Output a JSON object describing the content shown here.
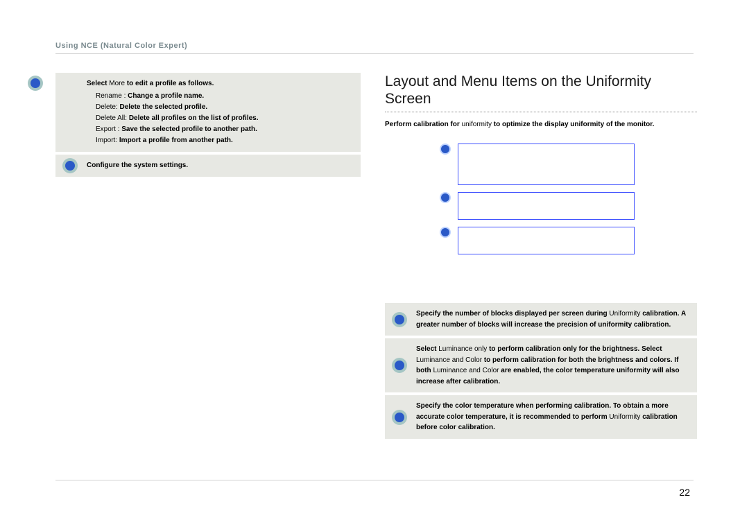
{
  "header": {
    "breadcrumb": "Using NCE (Natural Color Expert)"
  },
  "left": {
    "more_box": {
      "lead_strong": "Select",
      "lead_code": "More",
      "lead_tail": " to edit a profile as follows.",
      "items": [
        {
          "name": "Rename",
          "sep": " : ",
          "desc": "Change a profile name."
        },
        {
          "name": "Delete",
          "sep": ": ",
          "desc": "Delete the selected profile."
        },
        {
          "name": "Delete All",
          "sep": ": ",
          "desc": "Delete all profiles on the list of profiles."
        },
        {
          "name": "Export",
          "sep": " : ",
          "desc": "Save the selected profile to another path."
        },
        {
          "name": "Import",
          "sep": ": ",
          "desc": "Import a profile from another path."
        }
      ]
    },
    "settings_box": "Configure the system settings."
  },
  "right": {
    "title": "Layout and Menu Items on the Uniformity Screen",
    "intro_strong1": "Perform calibration for",
    "intro_code": "uniformity",
    "intro_strong2": " to optimize the display uniformity of the monitor.",
    "box1": {
      "t1": "Specify the number of blocks displayed per screen during ",
      "c1": "Uniformity",
      "t2": " calibration. A greater number of blocks will increase the precision of uniformity calibration."
    },
    "box2": {
      "t1": "Select",
      "c1": "Luminance only",
      "t2": " to perform calibration only for the brightness. Select ",
      "c2": "Luminance and Color",
      "t3": " to perform calibration for both the brightness and colors. If both",
      "c3": "Luminance and Color",
      "t4": " are enabled, the color temperature uniformity will also increase after calibration."
    },
    "box3": {
      "t1": "Specify the color temperature when performing calibration. To obtain a more accurate color temperature, it is recommended to perform ",
      "c1": "Uniformity",
      "t2": " calibration before color calibration."
    }
  },
  "page_number": "22"
}
